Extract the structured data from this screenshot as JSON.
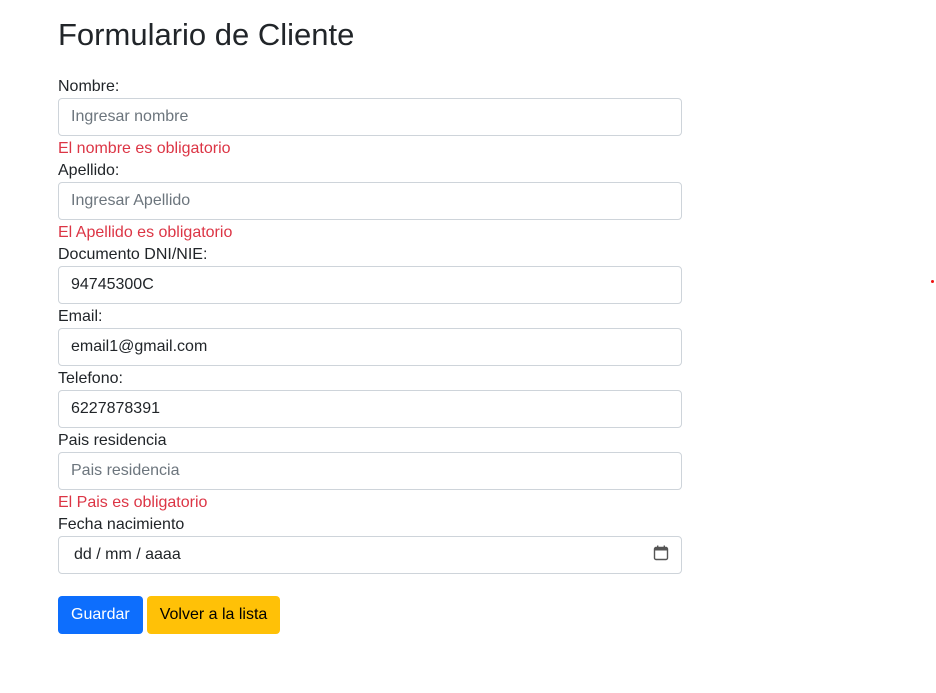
{
  "title": "Formulario de Cliente",
  "fields": [
    {
      "label": "Nombre:",
      "value": "",
      "placeholder": "Ingresar nombre",
      "error": "El nombre es obligatorio"
    },
    {
      "label": "Apellido:",
      "value": "",
      "placeholder": "Ingresar Apellido",
      "error": "El Apellido es obligatorio"
    },
    {
      "label": "Documento DNI/NIE:",
      "value": "94745300C"
    },
    {
      "label": "Email:",
      "value": "email1@gmail.com"
    },
    {
      "label": "Telefono:",
      "value": "6227878391"
    },
    {
      "label": "Pais residencia",
      "value": "",
      "placeholder": "Pais residencia",
      "error": "El Pais es obligatorio"
    },
    {
      "label": "Fecha nacimiento",
      "placeholder": "dd / mm / aaaa"
    }
  ],
  "buttons": {
    "save": "Guardar",
    "back": "Volver a la lista"
  },
  "colors": {
    "primary": "#0d6efd",
    "warning": "#ffc107",
    "error": "#dc3545"
  }
}
